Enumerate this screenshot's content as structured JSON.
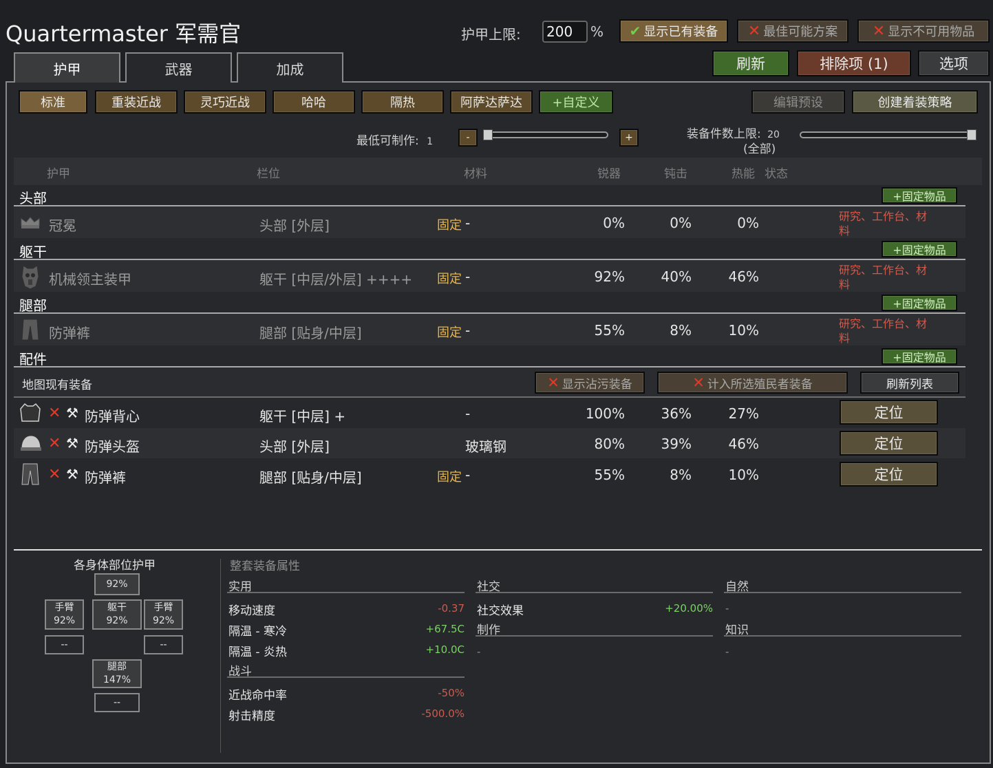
{
  "title": "Quartermaster 军需官",
  "armor_cap": {
    "label": "护甲上限:",
    "value": "200",
    "unit": "%"
  },
  "top_buttons": {
    "show_owned": "显示已有装备",
    "best_possible": "最佳可能方案",
    "show_unavailable": "显示不可用物品",
    "refresh": "刷新",
    "exclusions": "排除项 (1)",
    "options": "选项"
  },
  "tabs": [
    "护甲",
    "武器",
    "加成"
  ],
  "presets": [
    "标准",
    "重装近战",
    "灵巧近战",
    "哈哈",
    "隔热",
    "阿萨达萨达",
    "+自定义"
  ],
  "preset_actions": {
    "edit": "编辑预设",
    "create_policy": "创建着装策略"
  },
  "min_craftable": {
    "label": "最低可制作:",
    "value": "1",
    "minus": "-",
    "plus": "+",
    "fraction": 0.0
  },
  "max_items": {
    "label": "装备件数上限:",
    "value": "20",
    "sub": "(全部)",
    "fraction": 1.0
  },
  "table_headers": {
    "armor": "护甲",
    "slot": "栏位",
    "material": "材料",
    "sharp": "锐器",
    "blunt": "钝击",
    "heat": "热能",
    "status": "状态"
  },
  "fixed_item_label": "+固定物品",
  "fixed_text": "固定",
  "dash": "-",
  "sections": [
    {
      "name": "头部",
      "item": {
        "icon": "crown-icon",
        "name": "冠冕",
        "slot": "头部 [外层]",
        "sharp": "0%",
        "blunt": "0%",
        "heat": "0%",
        "req1": "研究、工作台、材",
        "req2": "料"
      }
    },
    {
      "name": "躯干",
      "item": {
        "icon": "mech-armor-icon",
        "name": "机械领主装甲",
        "slot": "躯干 [中层/外层] ++++",
        "sharp": "92%",
        "blunt": "40%",
        "heat": "46%",
        "req1": "研究、工作台、材",
        "req2": "料"
      }
    },
    {
      "name": "腿部",
      "item": {
        "icon": "pants-icon",
        "name": "防弹裤",
        "slot": "腿部 [贴身/中层]",
        "sharp": "55%",
        "blunt": "8%",
        "heat": "10%",
        "req1": "研究、工作台、材",
        "req2": "料"
      }
    },
    {
      "name": "配件"
    }
  ],
  "map_section": {
    "label": "地图现有装备",
    "show_tainted": "显示沾污装备",
    "count_colonists": "计入所选殖民者装备",
    "refresh_list": "刷新列表",
    "locate": "定位"
  },
  "map_items": [
    {
      "icon": "vest-icon",
      "name": "防弹背心",
      "slot": "躯干 [中层] +",
      "material": "-",
      "fixed": false,
      "sharp": "100%",
      "blunt": "36%",
      "heat": "27%"
    },
    {
      "icon": "helmet-icon",
      "name": "防弹头盔",
      "slot": "头部 [外层]",
      "material": "玻璃钢",
      "fixed": false,
      "sharp": "80%",
      "blunt": "39%",
      "heat": "46%"
    },
    {
      "icon": "pants-icon",
      "name": "防弹裤",
      "slot": "腿部 [贴身/中层]",
      "material": "-",
      "fixed": true,
      "sharp": "55%",
      "blunt": "8%",
      "heat": "10%"
    }
  ],
  "body_armor": {
    "title": "各身体部位护甲",
    "head": "92%",
    "left_arm": {
      "label": "手臂",
      "value": "92%"
    },
    "torso": {
      "label": "躯干",
      "value": "92%"
    },
    "right_arm": {
      "label": "手臂",
      "value": "92%"
    },
    "left_hand": "--",
    "right_hand": "--",
    "legs": {
      "label": "腿部",
      "value": "147%"
    },
    "feet": "--"
  },
  "overall": {
    "title": "整套装备属性",
    "practical": {
      "label": "实用",
      "stats": [
        {
          "name": "移动速度",
          "value": "-0.37"
        },
        {
          "name": "隔温 - 寒冷",
          "value": "+67.5C"
        },
        {
          "name": "隔温 - 炎热",
          "value": "+10.0C"
        }
      ]
    },
    "combat": {
      "label": "战斗",
      "stats": [
        {
          "name": "近战命中率",
          "value": "-50%"
        },
        {
          "name": "射击精度",
          "value": "-500.0%"
        }
      ]
    },
    "social": {
      "label": "社交",
      "stat_name": "社交效果",
      "stat_value": "+20.00%"
    },
    "crafting": {
      "label": "制作",
      "value": "-"
    },
    "nature": {
      "label": "自然",
      "value": "-"
    },
    "knowledge": {
      "label": "知识",
      "value": "-"
    }
  }
}
